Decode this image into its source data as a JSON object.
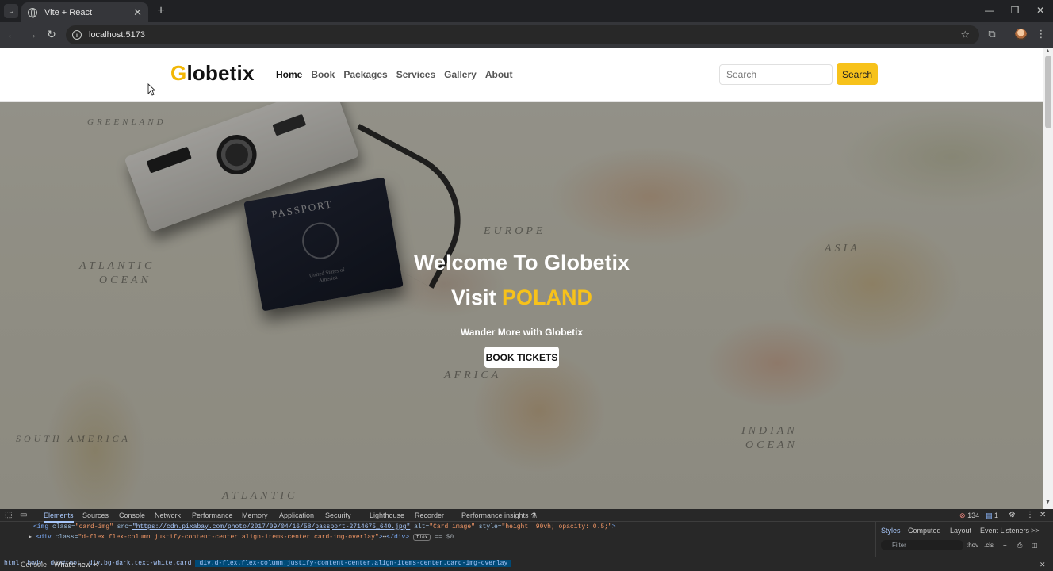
{
  "browser": {
    "tab_title": "Vite + React",
    "tab_close": "✕",
    "new_tab": "+",
    "url": "localhost:5173",
    "window_min": "—",
    "window_restore": "❐",
    "window_close": "✕"
  },
  "site": {
    "brand_first": "G",
    "brand_rest": "lobetix",
    "brand_accent_color": "#f2b705",
    "nav": [
      "Home",
      "Book",
      "Packages",
      "Services",
      "Gallery",
      "About"
    ],
    "search_placeholder": "Search",
    "search_button": "Search"
  },
  "hero": {
    "welcome": "Welcome To Globetix",
    "visit_prefix": "Visit",
    "country": "POLAND",
    "tagline": "Wander More with Globetix",
    "cta": "BOOK TICKETS",
    "map_labels": {
      "atlantic": "ATLANTIC",
      "ocean": "OCEAN",
      "europe": "EUROPE",
      "asia": "ASIA",
      "africa": "AFRICA",
      "indian": "INDIAN",
      "indian_ocean": "OCEAN",
      "south_america": "SOUTH AMERICA",
      "greenland": "GREENLAND",
      "atlantic_bottom": "ATLANTIC"
    },
    "passport_title": "PASSPORT",
    "passport_sub": "United States of America"
  },
  "devtools": {
    "tabs": [
      "Elements",
      "Sources",
      "Console",
      "Network",
      "Performance",
      "Memory",
      "Application",
      "Security",
      "Lighthouse",
      "Recorder",
      "Performance insights ⚗"
    ],
    "errors": "134",
    "messages": "1",
    "dom_line1": {
      "open": "<img",
      "class_attr": " class=",
      "class_val": "\"card-img\"",
      "src_attr": " src=",
      "src_val": "\"https://cdn.pixabay.com/photo/2017/09/04/16/58/passport-2714675_640.jpg\"",
      "alt_attr": " alt=",
      "alt_val": "\"Card image\"",
      "style_attr": " style=",
      "style_val": "\"height: 90vh; opacity: 0.5;\"",
      "close": ">"
    },
    "dom_line2": {
      "open": "<div",
      "class_attr": " class=",
      "class_val": "\"d-flex flex-column justify-content-center align-items-center card-img-overlay\"",
      "rest": ">",
      "ellipsis": "⋯",
      "close": "</div>",
      "badge": "flex",
      "eq": "== $0"
    },
    "breadcrumbs": [
      "html",
      "body",
      "div#root",
      "div.bg-dark.text-white.card",
      "div.d-flex.flex-column.justify-content-center.align-items-center.card-img-overlay"
    ],
    "styles_tabs": [
      "Styles",
      "Computed",
      "Layout",
      "Event Listeners",
      ">>"
    ],
    "filter_placeholder": "Filter",
    "hov": ":hov",
    "cls": ".cls",
    "drawer_tabs": [
      "Console",
      "What's new"
    ]
  }
}
